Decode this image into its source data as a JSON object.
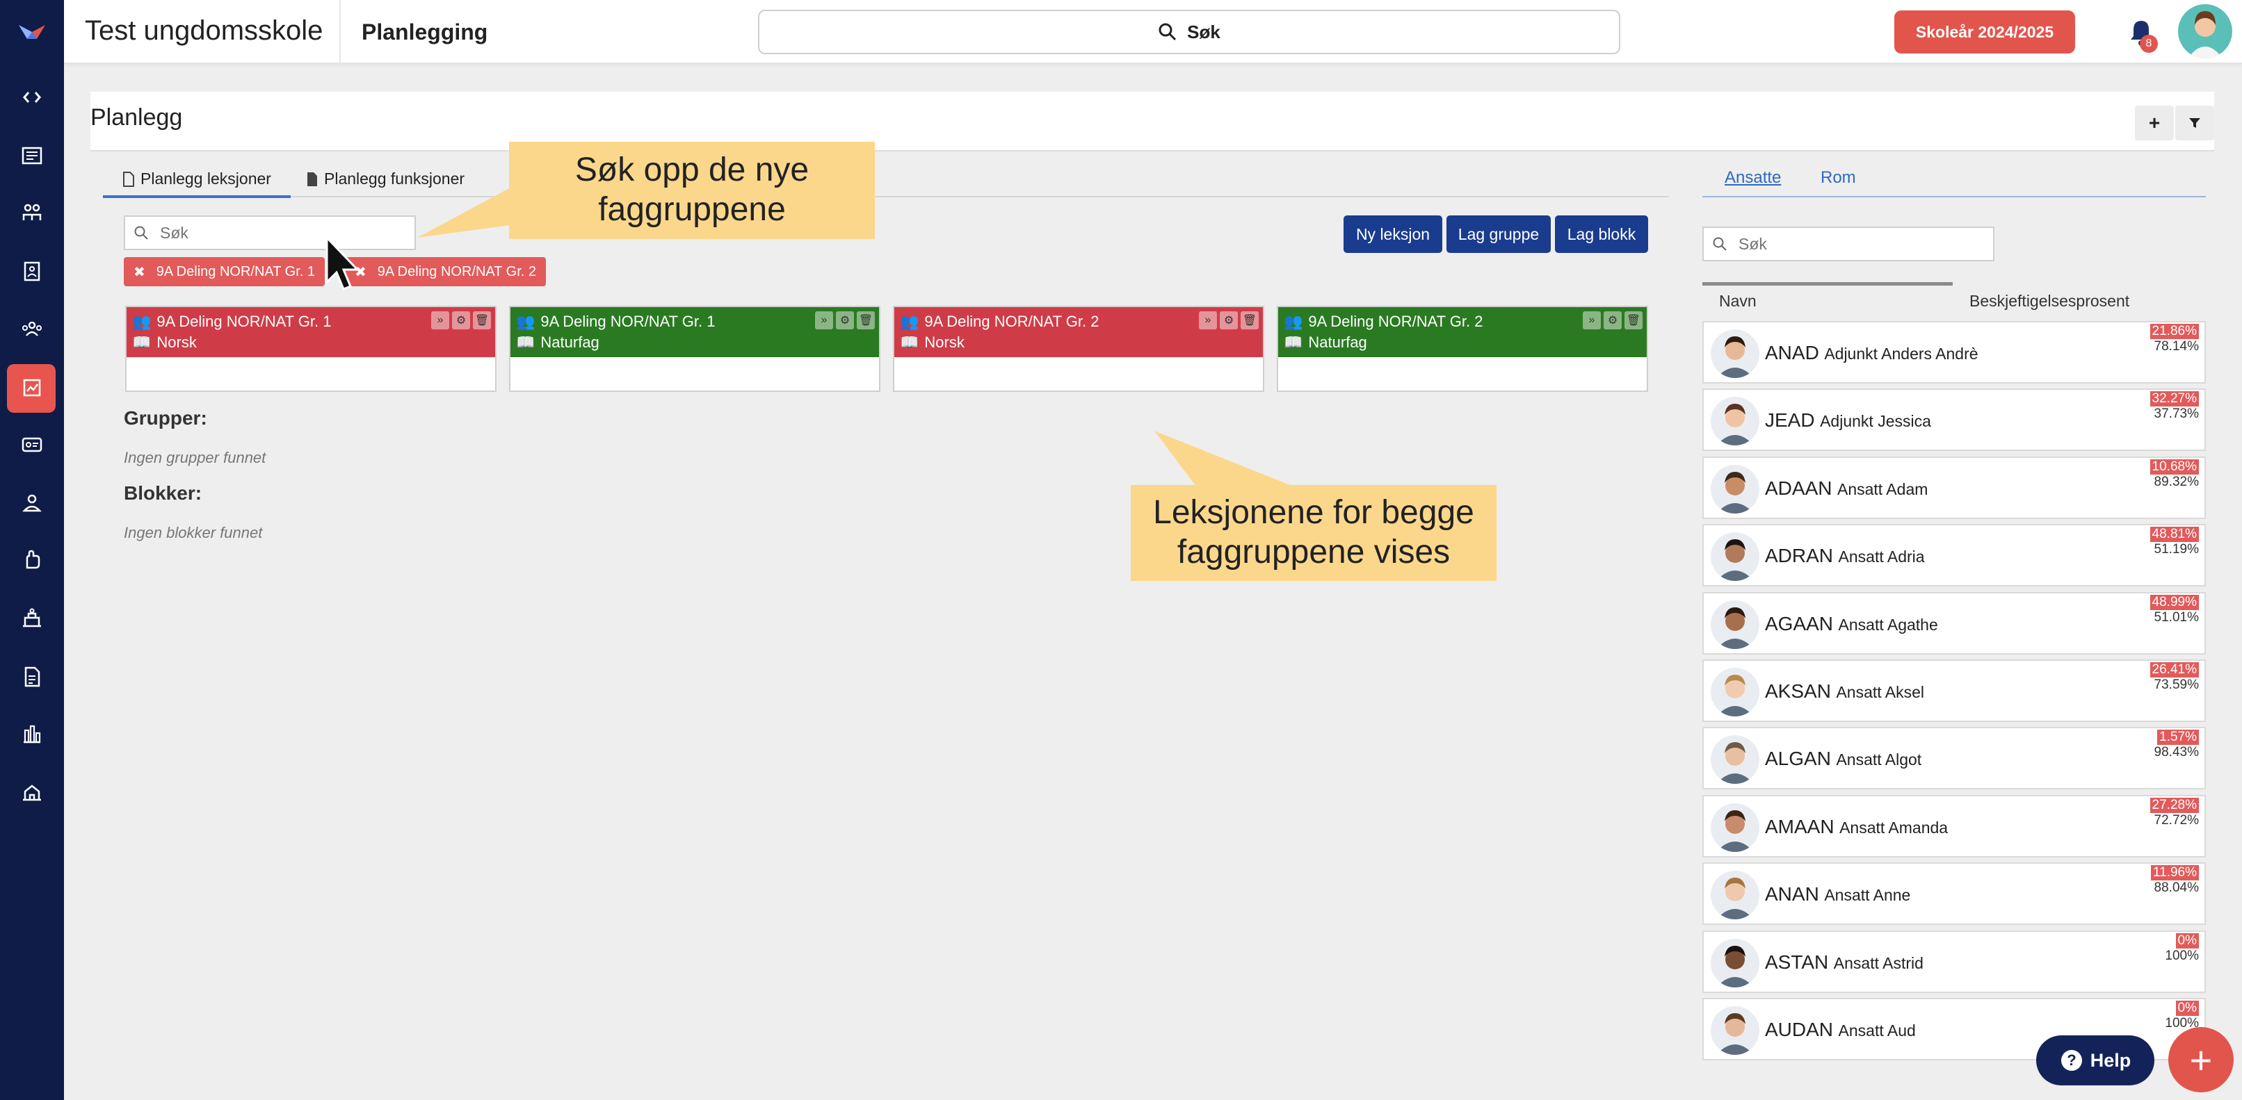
{
  "topbar": {
    "school": "Test ungdomsskole",
    "section": "Planlegging",
    "search_label": "Søk",
    "year_button": "Skoleår 2024/2025",
    "notification_count": "8"
  },
  "page": {
    "title": "Planlegg",
    "add_label": "+",
    "filter_label": "▼"
  },
  "tabs": [
    "Planlegg leksjoner",
    "Planlegg funksjoner"
  ],
  "left_search": {
    "placeholder": "Søk"
  },
  "actions": {
    "new_lesson": "Ny leksjon",
    "make_group": "Lag gruppe",
    "make_block": "Lag blokk"
  },
  "chips": [
    "9A Deling NOR/NAT Gr. 1",
    "9A Deling NOR/NAT Gr. 2"
  ],
  "cards": [
    {
      "group": "9A Deling NOR/NAT Gr. 1",
      "subject": "Norsk",
      "color": "#cf3c47"
    },
    {
      "group": "9A Deling NOR/NAT Gr. 1",
      "subject": "Naturfag",
      "color": "#2a7a22"
    },
    {
      "group": "9A Deling NOR/NAT Gr. 2",
      "subject": "Norsk",
      "color": "#cf3c47"
    },
    {
      "group": "9A Deling NOR/NAT Gr. 2",
      "subject": "Naturfag",
      "color": "#2a7a22"
    }
  ],
  "groups": {
    "title": "Grupper:",
    "empty": "Ingen grupper funnet"
  },
  "blocks": {
    "title": "Blokker:",
    "empty": "Ingen blokker funnet"
  },
  "callouts": {
    "search": "Søk opp de nye faggruppene",
    "lessons": "Leksjonene for begge faggruppene vises"
  },
  "right_panel": {
    "tabs": [
      "Ansatte",
      "Rom"
    ],
    "search_placeholder": "Søk",
    "col_name": "Navn",
    "col_pct": "Beskjeftigelsesprosent",
    "employees": [
      {
        "code": "ANAD",
        "name": "Adjunkt Anders Andrè",
        "free": "21.86%",
        "used": "78.14%"
      },
      {
        "code": "JEAD",
        "name": "Adjunkt Jessica",
        "free": "32.27%",
        "used": "37.73%"
      },
      {
        "code": "ADAAN",
        "name": "Ansatt Adam",
        "free": "10.68%",
        "used": "89.32%"
      },
      {
        "code": "ADRAN",
        "name": "Ansatt Adria",
        "free": "48.81%",
        "used": "51.19%"
      },
      {
        "code": "AGAAN",
        "name": "Ansatt Agathe",
        "free": "48.99%",
        "used": "51.01%"
      },
      {
        "code": "AKSAN",
        "name": "Ansatt Aksel",
        "free": "26.41%",
        "used": "73.59%"
      },
      {
        "code": "ALGAN",
        "name": "Ansatt Algot",
        "free": "1.57%",
        "used": "98.43%"
      },
      {
        "code": "AMAAN",
        "name": "Ansatt Amanda",
        "free": "27.28%",
        "used": "72.72%"
      },
      {
        "code": "ANAN",
        "name": "Ansatt Anne",
        "free": "11.96%",
        "used": "88.04%"
      },
      {
        "code": "ASTAN",
        "name": "Ansatt Astrid",
        "free": "0%",
        "used": "100%"
      },
      {
        "code": "AUDAN",
        "name": "Ansatt Aud",
        "free": "0%",
        "used": "100%"
      }
    ]
  },
  "help": {
    "label": "Help"
  }
}
